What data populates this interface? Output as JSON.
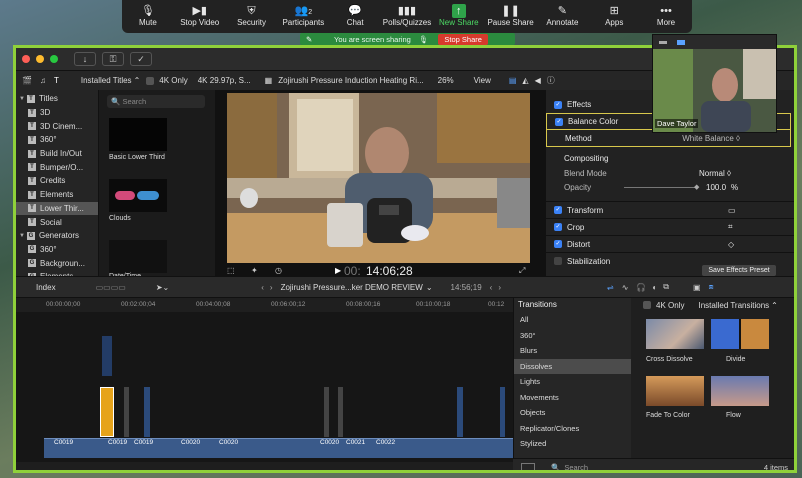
{
  "zoom_toolbar": {
    "items": [
      {
        "label": "Mute",
        "icon": "microphone-icon"
      },
      {
        "label": "Stop Video",
        "icon": "video-camera-icon"
      },
      {
        "label": "Security",
        "icon": "shield-icon"
      },
      {
        "label": "Participants",
        "icon": "people-icon",
        "count": "2"
      },
      {
        "label": "Chat",
        "icon": "chat-bubble-icon"
      },
      {
        "label": "Polls/Quizzes",
        "icon": "bar-chart-icon"
      },
      {
        "label": "New Share",
        "icon": "share-arrow-icon"
      },
      {
        "label": "Pause Share",
        "icon": "pause-icon"
      },
      {
        "label": "Annotate",
        "icon": "pencil-icon"
      },
      {
        "label": "Apps",
        "icon": "apps-icon"
      },
      {
        "label": "More",
        "icon": "more-dots-icon"
      }
    ]
  },
  "share_banner": {
    "message": "You are screen sharing",
    "stop_label": "Stop Share"
  },
  "fcp": {
    "browser_dropdown": "Installed Titles",
    "four_k": "4K Only",
    "format": "4K 29.97p, S...",
    "clip_title": "Zojirushi Pressure Induction Heating Ri...",
    "zoom": "26%",
    "view": "View",
    "sidebar": [
      {
        "label": "Titles",
        "level": 0,
        "open": true,
        "icon": "T"
      },
      {
        "label": "3D",
        "level": 1,
        "icon": "T"
      },
      {
        "label": "3D Cinem...",
        "level": 1,
        "icon": "T"
      },
      {
        "label": "360°",
        "level": 1,
        "icon": "T"
      },
      {
        "label": "Build In/Out",
        "level": 1,
        "icon": "T"
      },
      {
        "label": "Bumper/O...",
        "level": 1,
        "icon": "T"
      },
      {
        "label": "Credits",
        "level": 1,
        "icon": "T"
      },
      {
        "label": "Elements",
        "level": 1,
        "icon": "T"
      },
      {
        "label": "Lower Thir...",
        "level": 1,
        "icon": "T",
        "selected": true
      },
      {
        "label": "Social",
        "level": 1,
        "icon": "T"
      },
      {
        "label": "Generators",
        "level": 0,
        "open": true,
        "icon": "G"
      },
      {
        "label": "360°",
        "level": 1,
        "icon": "G"
      },
      {
        "label": "Backgroun...",
        "level": 1,
        "icon": "G"
      },
      {
        "label": "Elements",
        "level": 1,
        "icon": "G"
      }
    ],
    "search_placeholder": "Search",
    "title_tiles": [
      {
        "label": "Basic Lower Third"
      },
      {
        "label": "Clouds"
      },
      {
        "label": "Date/Time"
      }
    ],
    "timecode": "14:06;28",
    "timecode_prefix": "00:",
    "inspector": {
      "effects": "Effects",
      "balance_color": "Balance Color",
      "method": "Method",
      "method_value": "White Balance ◊",
      "compositing": "Compositing",
      "blend_mode": "Blend Mode",
      "blend_value": "Normal ◊",
      "opacity": "Opacity",
      "opacity_value": "100.0",
      "opacity_unit": "%",
      "transform": "Transform",
      "crop": "Crop",
      "distort": "Distort",
      "stabilization": "Stabilization",
      "save_preset": "Save Effects Preset"
    },
    "timeline": {
      "index": "Index",
      "project": "Zojirushi Pressure...ker DEMO REVIEW",
      "project_time": "14:56;19",
      "ruler": [
        "00:00:00;00",
        "00:02:00;04",
        "00:04:00;08",
        "00:06:00;12",
        "00:08:00;16",
        "00:10:00;18",
        "00:12"
      ],
      "clips": [
        "C0019",
        "C0019",
        "C0019",
        "C0020",
        "C0020",
        "C0020",
        "C0021",
        "C0022"
      ]
    },
    "transitions": {
      "header": "Transitions",
      "four_k": "4K Only",
      "installed": "Installed Transitions",
      "categories": [
        "All",
        "360°",
        "Blurs",
        "Dissolves",
        "Lights",
        "Movements",
        "Objects",
        "Replicator/Clones",
        "Stylized"
      ],
      "selected_category": "Dissolves",
      "items": [
        {
          "label": "Cross Dissolve"
        },
        {
          "label": "Divide"
        },
        {
          "label": "Fade To Color"
        },
        {
          "label": "Flow"
        }
      ],
      "search_placeholder": "Search",
      "count": "4 items"
    }
  },
  "pip": {
    "name": "Dave Taylor"
  }
}
